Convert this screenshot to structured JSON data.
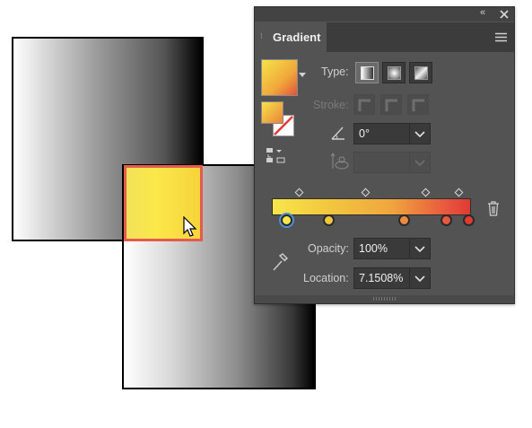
{
  "panel": {
    "tab_label": "Gradient",
    "type_label": "Type:",
    "stroke_label": "Stroke:",
    "angle_value": "0°",
    "opacity_label": "Opacity:",
    "opacity_value": "100%",
    "location_label": "Location:",
    "location_value": "7.1508%"
  },
  "gradient": {
    "stops": [
      "#f9e64b",
      "#f0c73a",
      "#ef8a3e",
      "#e9573e",
      "#e03a33"
    ],
    "selected_stop": 0
  },
  "colors": {
    "panel_bg": "#535353",
    "selection_border": "#e35b4d"
  }
}
